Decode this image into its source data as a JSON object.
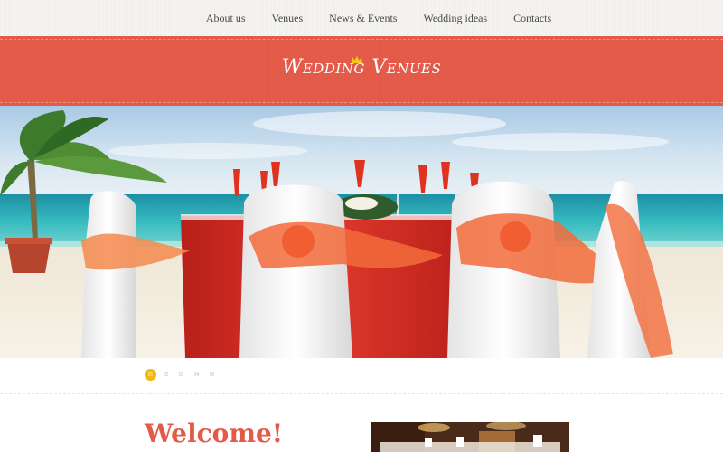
{
  "nav": {
    "items": [
      {
        "label": "About us"
      },
      {
        "label": "Venues"
      },
      {
        "label": "News & Events"
      },
      {
        "label": "Wedding ideas"
      },
      {
        "label": "Contacts"
      }
    ]
  },
  "header": {
    "logo_text": "Wedding Venues",
    "logo_icon": "crown-icon",
    "banner_color": "#e35a48"
  },
  "slider": {
    "image": "beach-wedding-table-photo",
    "pages": [
      "01",
      "02",
      "03",
      "04",
      "05"
    ],
    "active_page": "01",
    "accent_color": "#f0b70f"
  },
  "welcome": {
    "title": "Welcome!",
    "thumbnail": "banquet-hall-photo"
  }
}
